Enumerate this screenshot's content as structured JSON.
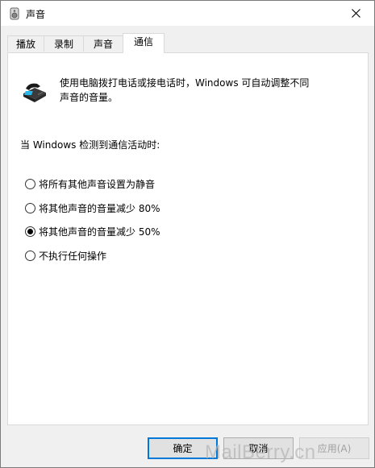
{
  "window": {
    "title": "声音"
  },
  "tabs": [
    {
      "label": "播放"
    },
    {
      "label": "录制"
    },
    {
      "label": "声音"
    },
    {
      "label": "通信"
    }
  ],
  "panel": {
    "description_line1": "使用电脑拨打电话或接电话时，Windows 可自动调整不同",
    "description_line2": "声音的音量。",
    "section_label": "当 Windows 检测到通信活动时:",
    "options": [
      {
        "label": "将所有其他声音设置为静音",
        "selected": false
      },
      {
        "label": "将其他声音的音量减少 80%",
        "selected": false
      },
      {
        "label": "将其他声音的音量减少 50%",
        "selected": true
      },
      {
        "label": "不执行任何操作",
        "selected": false
      }
    ]
  },
  "buttons": {
    "ok": "确定",
    "cancel": "取消",
    "apply": "应用(A)"
  },
  "watermark": "MailBerry.cn"
}
